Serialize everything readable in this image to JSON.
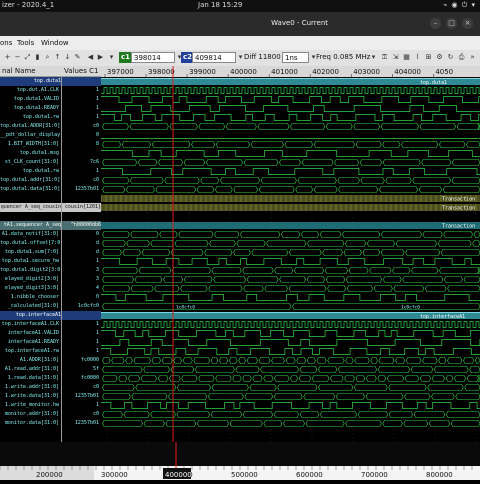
{
  "system_bar": {
    "app_menu": "izer - 2020.4_1",
    "clock": "Jan 18  15:29",
    "tray": "⌁ ◉ ⏻ ▾"
  },
  "window": {
    "title": "Wave0 - Current",
    "minimize": "–",
    "maximize": "□",
    "close": "×"
  },
  "menu": {
    "items": [
      "ons",
      "Tools",
      "Window"
    ]
  },
  "toolbar": {
    "cursor1_label": "c1",
    "cursor1_value": "398014",
    "cursor2_label": "c2",
    "cursor2_value": "409814",
    "diff_label": "Diff 11800",
    "diff_unit": "1ns",
    "freq_label": "Freq 0.085 MHz"
  },
  "headers": {
    "signal_name": "nal Name",
    "values": "Values C1"
  },
  "time_ruler": [
    "397000",
    "398000",
    "399000",
    "400000",
    "401000",
    "402000",
    "403000",
    "404000",
    "4050"
  ],
  "cursor_time": "398014",
  "overview_ruler": [
    "200000",
    "300000",
    "400000",
    "500000",
    "600000",
    "700000",
    "800000"
  ],
  "overview_cursor": "400000",
  "rows": [
    {
      "name": "top.duta1",
      "value": "",
      "kind": "banner",
      "wave": "banner",
      "label": "top.duta1"
    },
    {
      "name": "top.dut.A1.CLK",
      "value": "1",
      "kind": "normal",
      "wave": "clock"
    },
    {
      "name": "top.duta1.VALID",
      "value": "1",
      "kind": "normal",
      "wave": "toggle"
    },
    {
      "name": "top.duta1.READY",
      "value": "1",
      "kind": "normal",
      "wave": "toggle2"
    },
    {
      "name": "top.duta1.rw",
      "value": "1",
      "kind": "normal",
      "wave": "toggle"
    },
    {
      "name": "top.duta1.ADDR[31:0]",
      "value": "c0",
      "kind": "normal",
      "wave": "bus"
    },
    {
      "name": "__pdt_dollar_display",
      "value": "0",
      "kind": "normal",
      "wave": "low"
    },
    {
      "name": "1.BIT_WIDTH[31:0]",
      "value": "8",
      "kind": "normal",
      "wave": "bus"
    },
    {
      "name": "top.duta1.msg",
      "value": "",
      "kind": "normal",
      "wave": "pulses"
    },
    {
      "name": "st_CLK_count[31:0]",
      "value": "7c6",
      "kind": "normal",
      "wave": "bus"
    },
    {
      "name": "top.duta1.rw",
      "value": "1",
      "kind": "normal",
      "wave": "toggle2"
    },
    {
      "name": "top.duta1.addr[31:0]",
      "value": "c0",
      "kind": "normal",
      "wave": "bus"
    },
    {
      "name": "top.duta1.data[31:0]",
      "value": "12357b01",
      "kind": "normal",
      "wave": "bus"
    },
    {
      "name": "",
      "value": "",
      "kind": "normal",
      "wave": "transaction_grid",
      "label": "Transaction"
    },
    {
      "name": "quencer A_seq_cousin",
      "value": "cousin{1201}",
      "kind": "highlight",
      "wave": "transaction",
      "label": "Transaction"
    },
    {
      "name": "",
      "value": "",
      "kind": "normal",
      "wave": "empty"
    },
    {
      "name": "tA1.sequencer A_seq",
      "value": "^h00000db6",
      "kind": "band",
      "wave": "teal",
      "label": "Transaction"
    },
    {
      "name": "A1.data_notif[31:0]",
      "value": "0",
      "kind": "normal",
      "wave": "bus"
    },
    {
      "name": "top.duta1.offset[7:0]",
      "value": "d",
      "kind": "normal",
      "wave": "bus"
    },
    {
      "name": "top.duta1.sum[7:0]",
      "value": "d",
      "kind": "normal",
      "wave": "bus"
    },
    {
      "name": "top.duta1.secure_hw",
      "value": "1",
      "kind": "normal",
      "wave": "toggle"
    },
    {
      "name": "top.duta1.digit2[3:0]",
      "value": "3",
      "kind": "normal",
      "wave": "bus"
    },
    {
      "name": "elayed_digit2[3:0]",
      "value": "3",
      "kind": "normal",
      "wave": "bus"
    },
    {
      "name": "elayed_digit3[3:0]",
      "value": "4",
      "kind": "normal",
      "wave": "bus"
    },
    {
      "name": "1.nibble_chooser",
      "value": "0",
      "kind": "normal",
      "wave": "toggle2"
    },
    {
      "name": "_calculated[31:0]",
      "value": "1c0cfc0",
      "kind": "normal",
      "wave": "bus_long",
      "label": "1c0cfc0"
    },
    {
      "name": "top.interfaceA1",
      "value": "",
      "kind": "banner",
      "wave": "banner",
      "label": "top.interfaceA1"
    },
    {
      "name": "top.interfaceA1.CLK",
      "value": "1",
      "kind": "normal",
      "wave": "clock"
    },
    {
      "name": "interfaceA1.VALID",
      "value": "1",
      "kind": "normal",
      "wave": "toggle"
    },
    {
      "name": "interfaceA1.READY",
      "value": "1",
      "kind": "normal",
      "wave": "toggle2"
    },
    {
      "name": "top.interfaceA1.rw",
      "value": "1",
      "kind": "normal",
      "wave": "toggle"
    },
    {
      "name": "A1.ADDR[31:0]",
      "value": "fc0000",
      "kind": "normal",
      "wave": "bus_dense"
    },
    {
      "name": "A1.read.addr[31:0]",
      "value": "5f",
      "kind": "normal",
      "wave": "bus"
    },
    {
      "name": "1.read.data[31:0]",
      "value": "fc0000",
      "kind": "normal",
      "wave": "bus_dense"
    },
    {
      "name": "1.write.addr[31:0]",
      "value": "c0",
      "kind": "normal",
      "wave": "bus"
    },
    {
      "name": "1.write.data[31:0]",
      "value": "12357b01",
      "kind": "normal",
      "wave": "bus"
    },
    {
      "name": "1.write_monitor.hw",
      "value": "1",
      "kind": "normal",
      "wave": "toggle"
    },
    {
      "name": "monitor.addr[31:0]",
      "value": "c0",
      "kind": "normal",
      "wave": "bus"
    },
    {
      "name": "monitor.data[31:0]",
      "value": "12357b01",
      "kind": "normal",
      "wave": "bus"
    }
  ],
  "colors": {
    "wave": "#2fd24a",
    "bus_text": "#9af0ff",
    "cursor": "#e01c1c",
    "banner": "#2f8a94",
    "selection": "#1e3c7a",
    "transaction": "#9aa335",
    "background": "#000000"
  }
}
